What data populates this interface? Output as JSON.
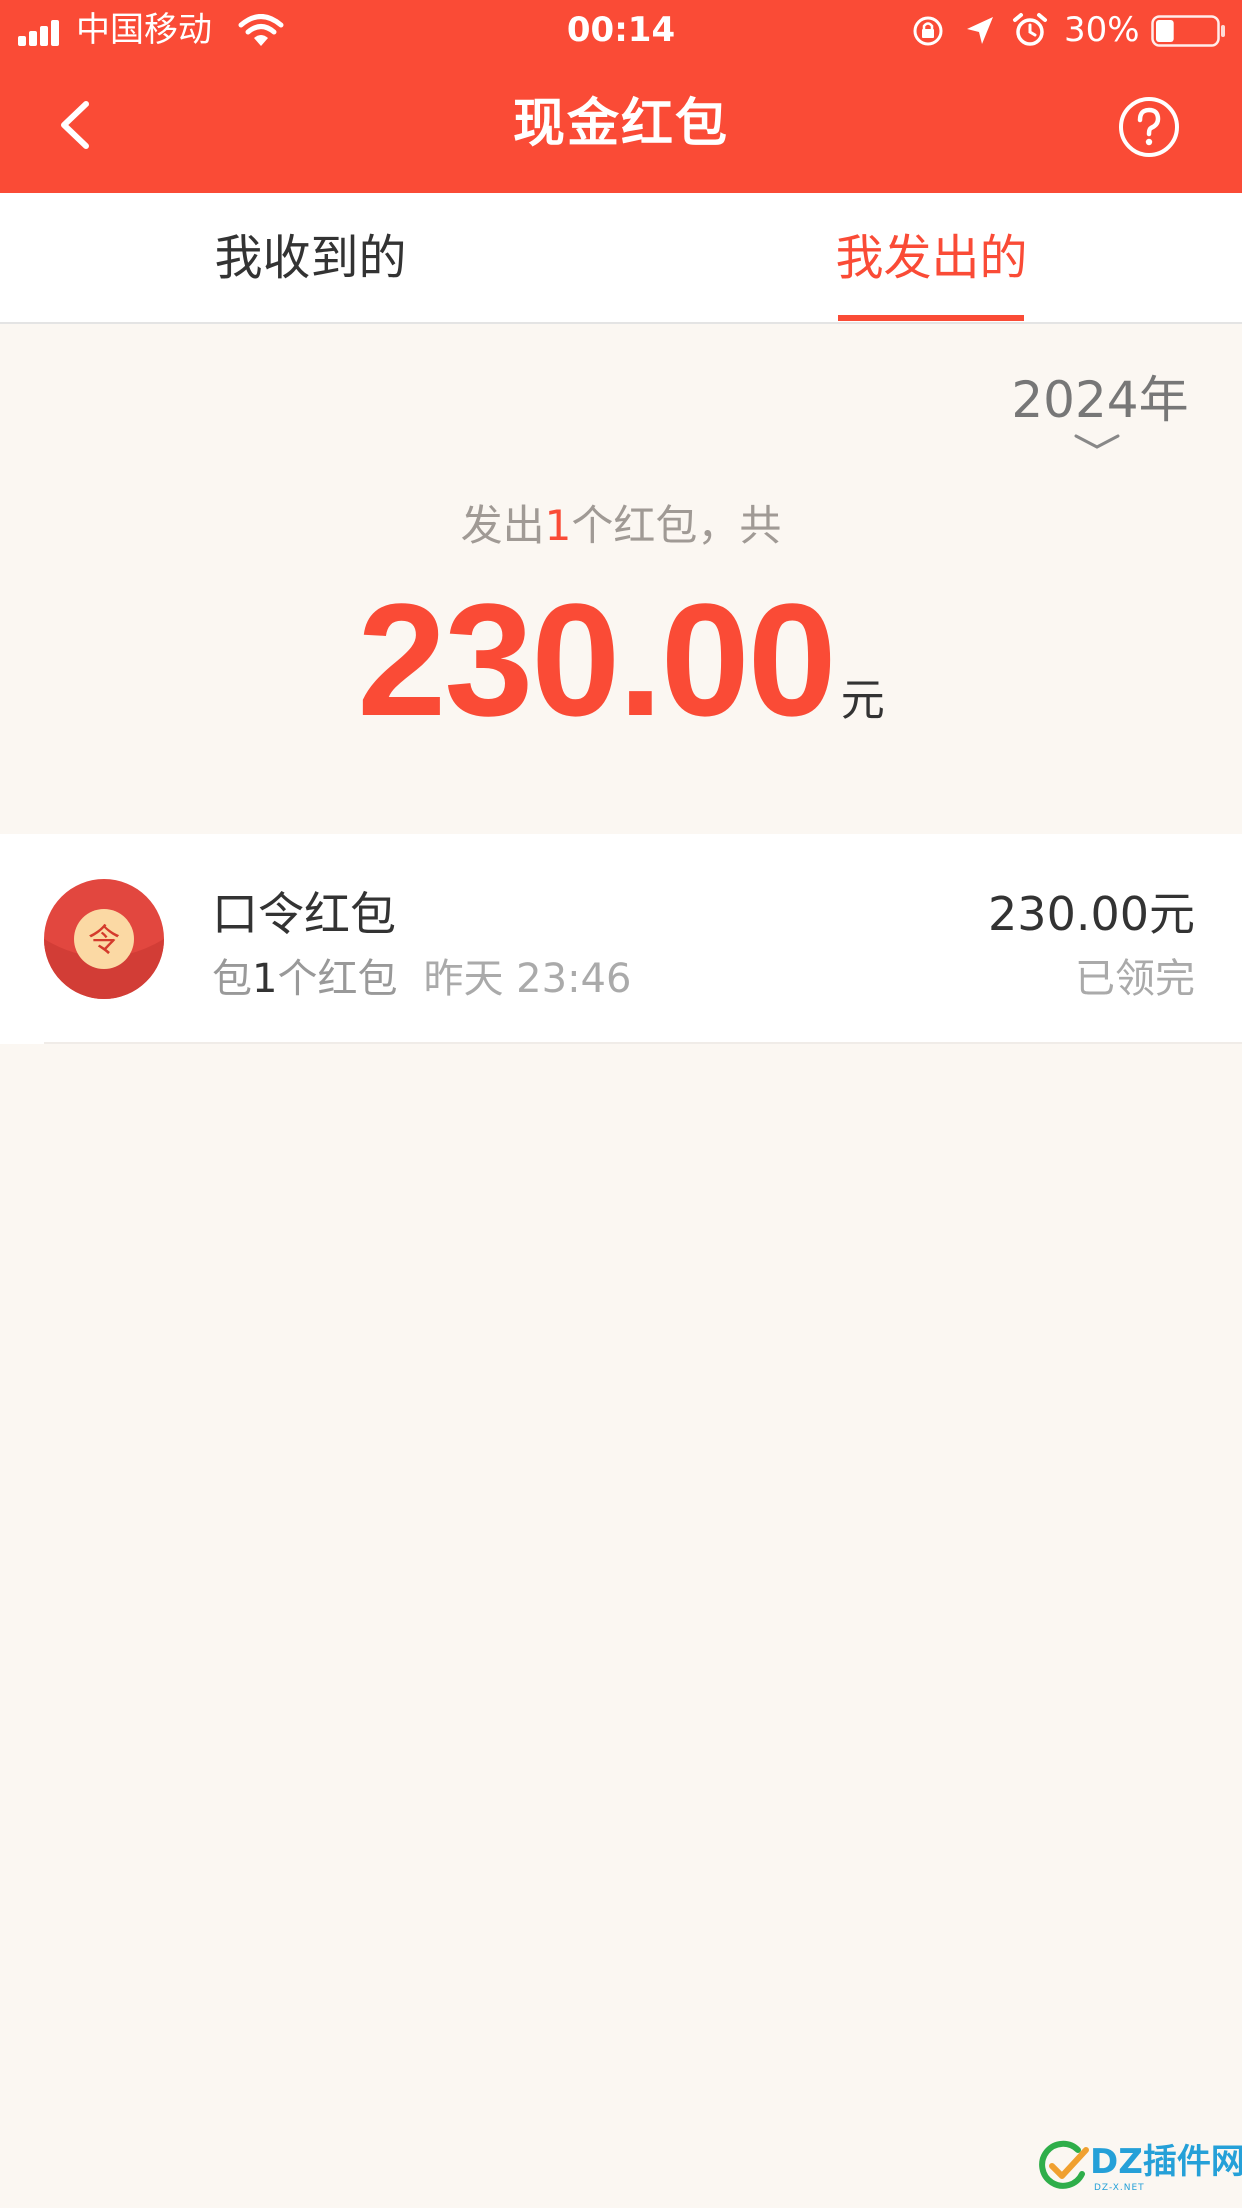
{
  "status_bar": {
    "carrier": "中国移动",
    "time": "00:14",
    "battery_percent": "30%",
    "battery_level": 0.3
  },
  "nav": {
    "title": "现金红包"
  },
  "tabs": [
    {
      "label": "我收到的",
      "active": false
    },
    {
      "label": "我发出的",
      "active": true
    }
  ],
  "summary": {
    "year": "2024年",
    "prefix": "发出",
    "count": "1",
    "suffix": "个红包，共",
    "amount": "230.00",
    "unit": "元"
  },
  "records": [
    {
      "icon_glyph": "令",
      "title": "口令红包",
      "desc_pre": "包",
      "desc_count": "1",
      "desc_post": "个红包",
      "time": "昨天 23:46",
      "amount": "230.00元",
      "status": "已领完"
    }
  ],
  "watermark": {
    "text": "DZ插件网",
    "sub": "DZ-X.NET"
  },
  "colors": {
    "brand_red": "#fa4b36",
    "page_bg": "#fbf7f2"
  }
}
